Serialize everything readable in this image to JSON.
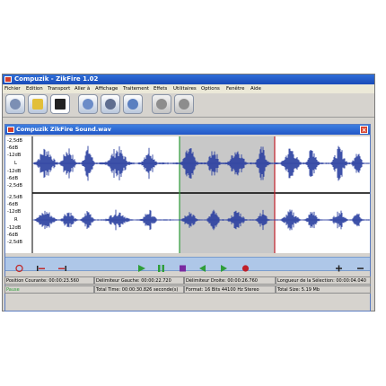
{
  "window": {
    "title": "Compuzik - ZikFire 1.02"
  },
  "menu": [
    "Fichier",
    "Edition",
    "Transport",
    "Aller à",
    "Affichage",
    "Traitement",
    "Effets",
    "Utilitaires",
    "Options",
    "Fenêtre",
    "Aide"
  ],
  "toolbar_icons": [
    "new-icon",
    "open-icon",
    "save-icon",
    "zoom-icon",
    "cut-icon",
    "paste-icon",
    "undo-icon",
    "redo-icon"
  ],
  "document": {
    "title": "Compuzik ZikFire Sound.wav"
  },
  "scale_labels": [
    "-2,5dB",
    "-6dB",
    "-12dB",
    "L",
    "-12dB",
    "-6dB",
    "-2,5dB",
    "-2,5dB",
    "-6dB",
    "-12dB",
    "R",
    "-12dB",
    "-6dB",
    "-2,5dB"
  ],
  "transport_icons": [
    "loop-icon",
    "to-start-icon",
    "to-end-icon",
    "play-icon",
    "pause-icon",
    "stop-icon",
    "rewind-icon",
    "forward-icon",
    "record-icon",
    "zoom-in-icon",
    "zoom-out-icon"
  ],
  "colors": {
    "selection": "#c8c8c8",
    "waveform": "#2a3fa0",
    "left_marker": "#2e9e3a",
    "right_marker": "#c0202a"
  },
  "status": {
    "pos_label": "Position Courante: 00:00:23.560",
    "left_delim": "Délimiteur Gauche: 00:00:22.720",
    "right_delim": "Délimiteur Droite: 00:00:26.760",
    "sel_len": "Longueur de la Sélection: 00:00:04.040",
    "state": "Pause",
    "total_time": "Total Time: 00:00:30.826 seconde(s)",
    "format": "Format: 16 Bits 44100 Hz  Stereo",
    "total_size": "Total Size: 5.19 Mb"
  }
}
